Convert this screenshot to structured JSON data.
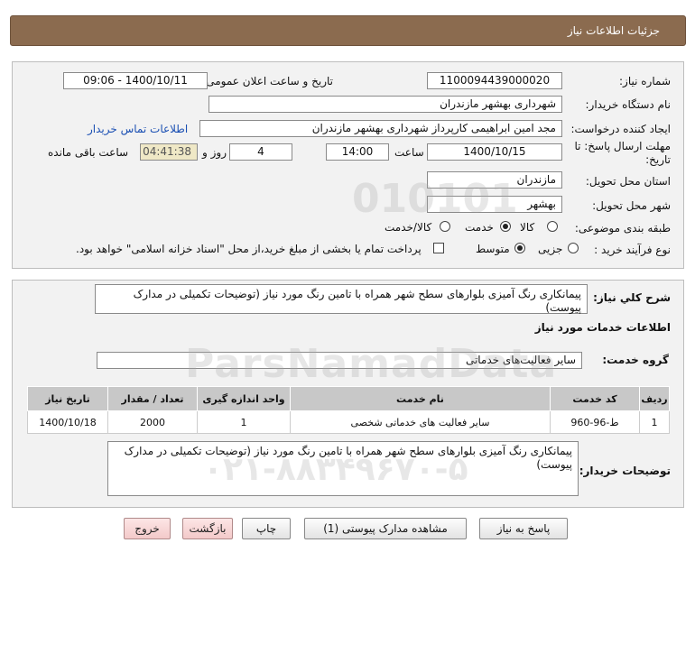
{
  "header": {
    "title": "جزئیات اطلاعات نیاز"
  },
  "details": {
    "need_number_label": "شماره نیاز:",
    "need_number": "1100094439000020",
    "announce_label": "تاریخ و ساعت اعلان عمومی:",
    "announce_value": "1400/10/11 - 09:06",
    "buyer_org_label": "نام دستگاه خریدار:",
    "buyer_org": "شهرداری بهشهر مازندران",
    "requester_label": "ایجاد کننده درخواست:",
    "requester": "مجد امین ابراهیمی کارپرداز شهرداری بهشهر مازندران",
    "contact_link": "اطلاعات تماس خریدار",
    "deadline_label_1": "مهلت ارسال پاسخ: تا",
    "deadline_label_2": "تاریخ:",
    "deadline_date": "1400/10/15",
    "time_label": "ساعت",
    "deadline_time": "14:00",
    "days_value": "4",
    "days_label": "روز و",
    "remaining_time": "04:41:38",
    "remaining_label": "ساعت باقی مانده",
    "province_label": "استان محل تحویل:",
    "province": "مازندران",
    "city_label": "شهر محل تحویل:",
    "city": "بهشهر",
    "category_label": "طبقه بندی موضوعی:",
    "category_options": [
      "کالا",
      "خدمت",
      "کالا/خدمت"
    ],
    "category_selected": "خدمت",
    "purchase_type_label": "نوع فرآیند خرید :",
    "purchase_options": [
      "جزیی",
      "متوسط"
    ],
    "purchase_selected": "متوسط",
    "payment_note": "پرداخت تمام یا بخشی از مبلغ خرید،از محل \"اسناد خزانه اسلامی\" خواهد بود."
  },
  "summary": {
    "label": "شرح کلي نياز:",
    "text": "پیمانکاری رنگ آمیزی بلوارهای سطح شهر همراه با تامین رنگ مورد نیاز (توضیحات تکمیلی در مدارک پیوست)"
  },
  "services": {
    "section_title": "اطلاعات خدمات مورد نیاز",
    "group_label": "گروه خدمت:",
    "group_value": "سایر فعالیت‌های خدماتی",
    "table": {
      "headers": [
        "ردیف",
        "کد خدمت",
        "نام خدمت",
        "واحد اندازه گیری",
        "تعداد / مقدار",
        "تاریخ نیاز"
      ],
      "rows": [
        [
          "1",
          "ط-96-960",
          "سایر فعالیت های خدماتی شخصی",
          "1",
          "2000",
          "1400/10/18"
        ]
      ]
    },
    "buyer_desc_label": "توضیحات خریدار:",
    "buyer_desc": "پیمانکاری رنگ آمیزی بلوارهای سطح شهر همراه با تامین رنگ مورد نیاز (توضیحات تکمیلی در مدارک پیوست)"
  },
  "buttons": {
    "reply": "پاسخ به نیاز",
    "view_docs": "مشاهده مدارک پیوستی (1)",
    "print": "چاپ",
    "back": "بازگشت",
    "exit": "خروج"
  },
  "watermark": {
    "brand": "ParsNamadData",
    "phone": "۰۲۱-۸۸۳۴۹۶۷۰-۵",
    "number": "010101"
  }
}
